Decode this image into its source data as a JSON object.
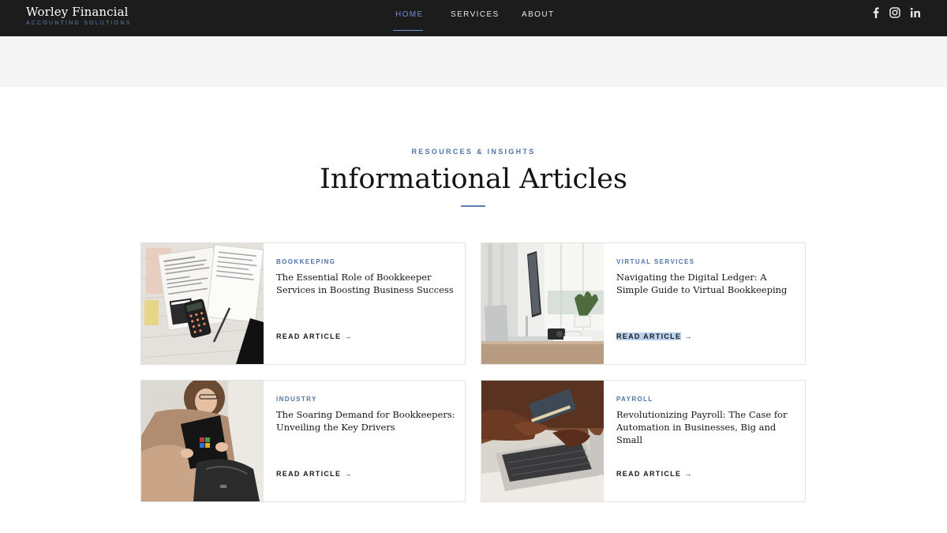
{
  "header": {
    "brand_name": "Worley Financial",
    "brand_tagline": "ACCOUNTING SOLUTIONS",
    "nav": [
      {
        "label": "HOME",
        "active": true
      },
      {
        "label": "SERVICES",
        "active": false
      },
      {
        "label": "ABOUT",
        "active": false
      }
    ],
    "social_icons": [
      "facebook-icon",
      "instagram-icon",
      "linkedin-icon"
    ]
  },
  "section": {
    "eyebrow": "RESOURCES & INSIGHTS",
    "title": "Informational Articles"
  },
  "articles": [
    {
      "category": "BOOKKEEPING",
      "title": "The Essential Role of Bookkeeper Services in Boosting Business Success",
      "link_label": "READ ARTICLE",
      "link_selected": false,
      "image": "tax-forms-calculator-photo"
    },
    {
      "category": "VIRTUAL SERVICES",
      "title": "Navigating the Digital Ledger: A Simple Guide to Virtual Bookkeeping",
      "link_label": "READ ARTICLE",
      "link_selected": true,
      "image": "desk-computer-photo"
    },
    {
      "category": "INDUSTRY",
      "title": "The Soaring Demand for Bookkeepers: Unveiling the Key Drivers",
      "link_label": "READ ARTICLE",
      "link_selected": false,
      "image": "woman-with-laptop-bag-photo"
    },
    {
      "category": "PAYROLL",
      "title": "Revolutionizing Payroll: The Case for Automation in Businesses, Big and Small",
      "link_label": "READ ARTICLE",
      "link_selected": false,
      "image": "card-payment-laptop-photo"
    }
  ],
  "colors": {
    "header_bg": "#1c1c1c",
    "accent": "#5b7fb3",
    "nav_active": "#6e94c8",
    "selection_highlight": "#b9d3ee"
  }
}
